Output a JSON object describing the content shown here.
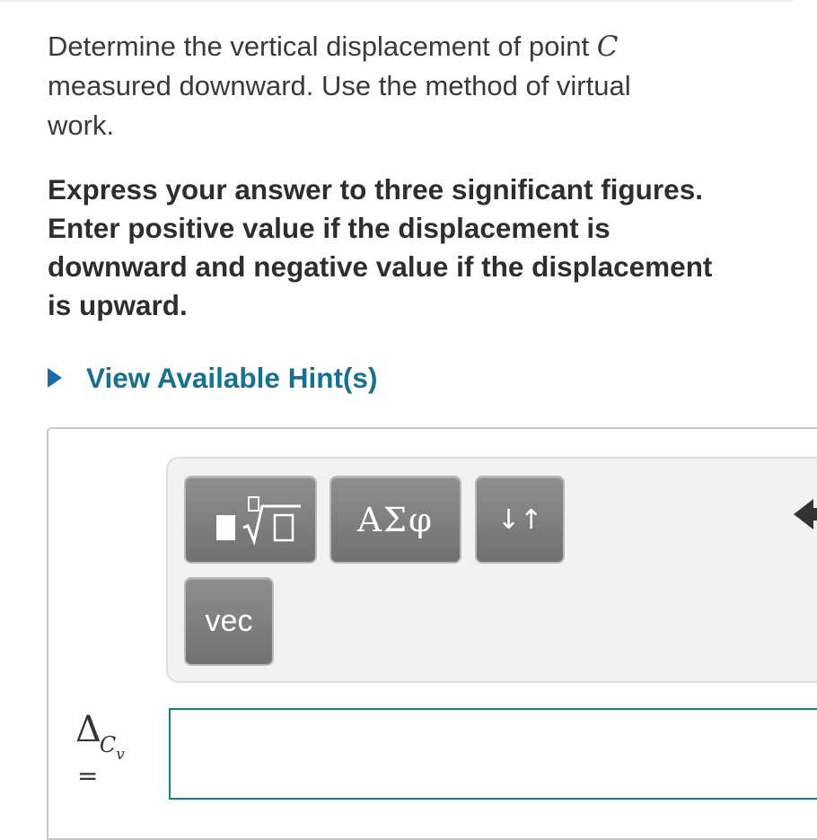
{
  "question": {
    "line1_prefix": "Determine the vertical displacement of point ",
    "point_var": "C",
    "line2": "measured downward. Use the method of virtual",
    "line3": "work."
  },
  "instructions": {
    "line1": "Express your answer to three significant figures.",
    "line2": "Enter positive value if the displacement is",
    "line3": "downward and negative value if the displacement",
    "line4": "is upward."
  },
  "hint": {
    "label": "View Available Hint(s)",
    "color": "#16708f",
    "arrow_color": "#1c6aa6"
  },
  "toolbar": {
    "templates_icon": "templates-radical-icon",
    "greek_label": "ΑΣφ",
    "arrows_label": "↓↑",
    "vec_label": "vec",
    "undo_icon": "undo-arrow-icon"
  },
  "answer": {
    "delta": "Δ",
    "subscript": "C",
    "subsubscript": "v",
    "equals": "=",
    "value": "",
    "border_color": "#1a7c84"
  }
}
